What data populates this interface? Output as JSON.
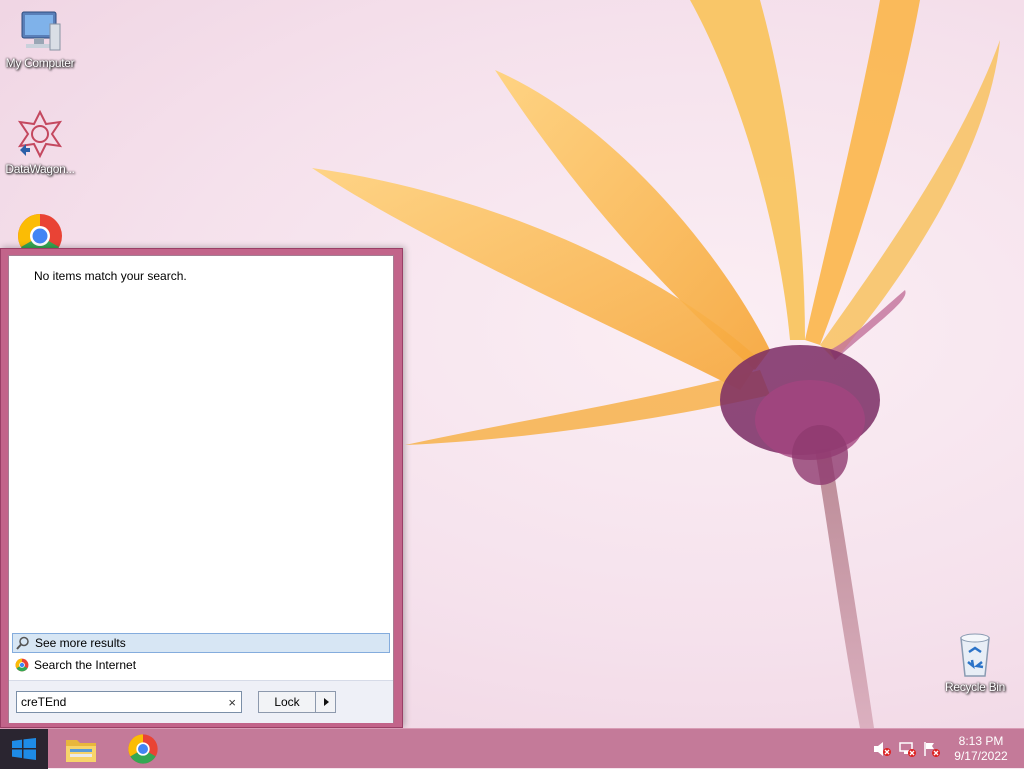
{
  "desktop": {
    "icons": [
      {
        "label": "My Computer",
        "icon": "computer-icon"
      },
      {
        "label": "DataWagon...",
        "icon": "datawagon-icon"
      },
      {
        "label": "",
        "icon": "chrome-icon"
      },
      {
        "label": "Recycle Bin",
        "icon": "recycle-bin-icon"
      }
    ]
  },
  "start_menu": {
    "no_results_text": "No items match your search.",
    "see_more_label": "See more results",
    "search_internet_label": "Search the Internet",
    "search_value": "creTEnd",
    "clear_symbol": "×",
    "lock_label": "Lock"
  },
  "taskbar": {
    "apps": [
      "file-explorer-icon",
      "chrome-icon"
    ],
    "tray": [
      "volume-muted-icon",
      "network-icon",
      "action-center-flag-icon"
    ],
    "time": "8:13 PM",
    "date": "9/17/2022"
  },
  "colors": {
    "menu_frame": "#c2648a",
    "taskbar": "#c47a99",
    "start_button": "#2a2530",
    "highlight": "#d7e6f4"
  }
}
